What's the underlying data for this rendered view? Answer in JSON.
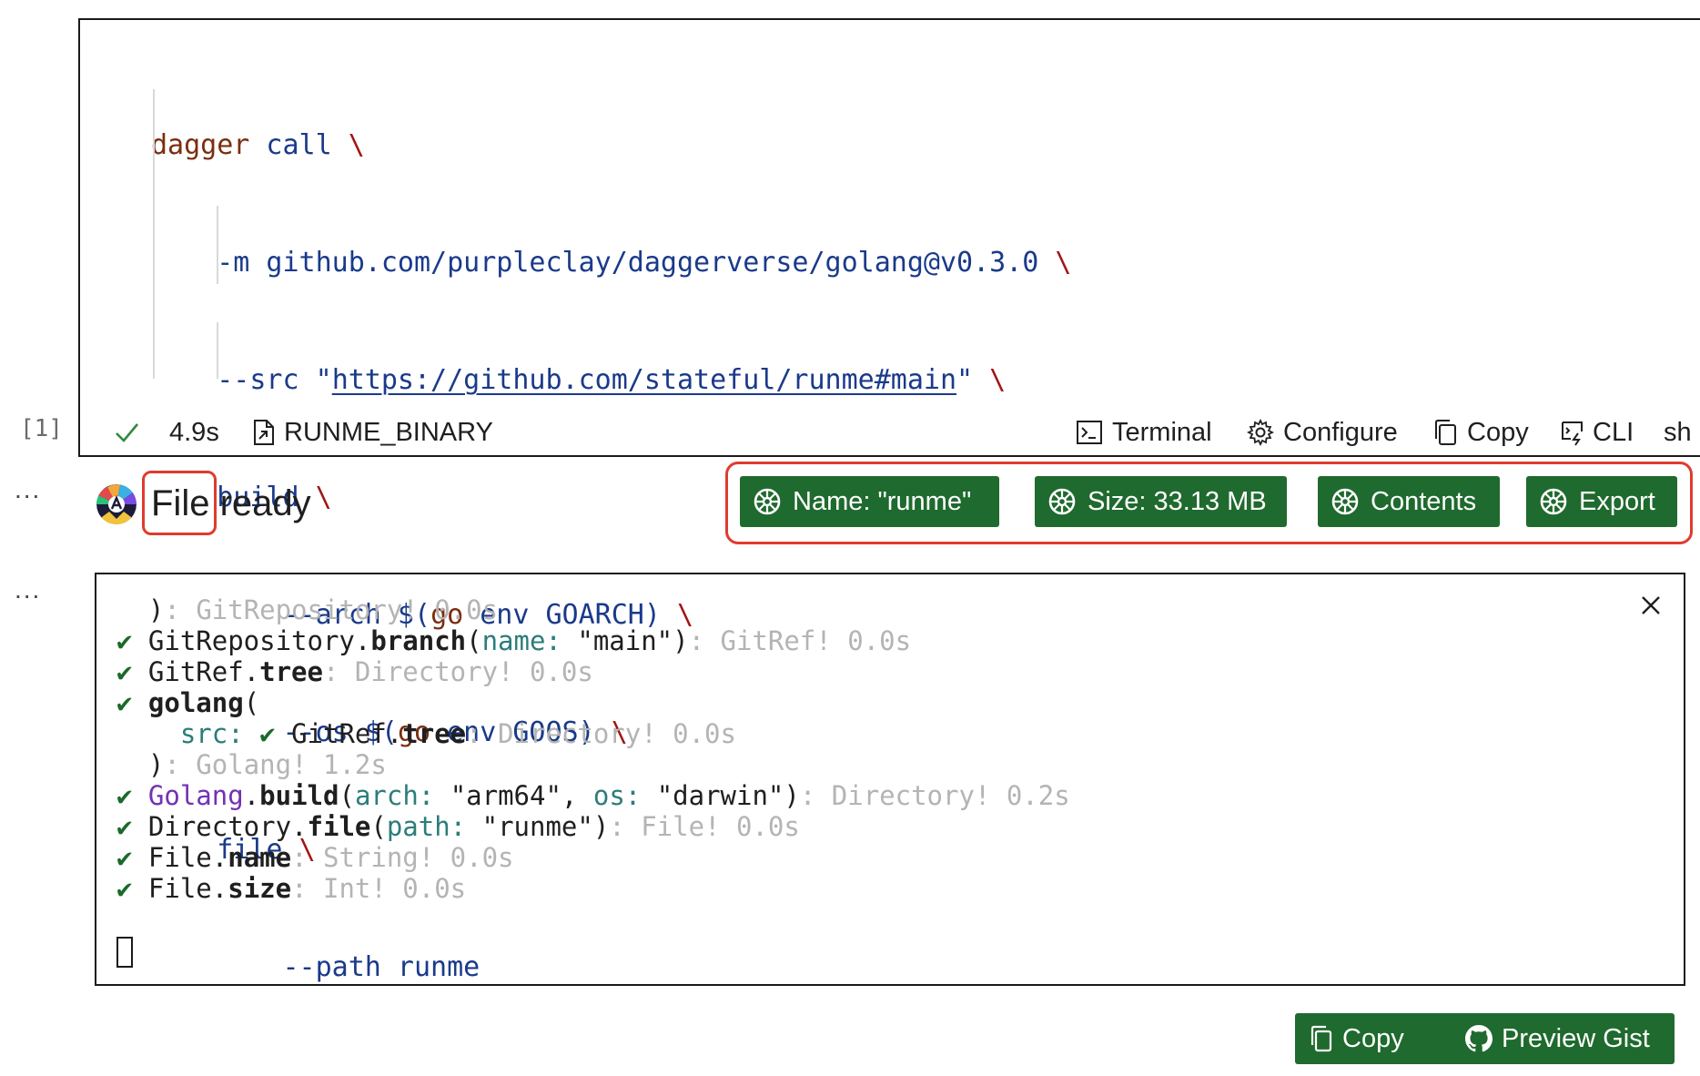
{
  "code_cell": {
    "lines": [
      {
        "kw": "dagger",
        "rest": " call ",
        "bs": "\\"
      },
      {
        "flag": "-m",
        "val": " github.com/purpleclay/daggerverse/golang@v0.3.0 ",
        "bs": "\\"
      },
      {
        "flag": "--src",
        "pre": " \"",
        "url": "https://github.com/stateful/runme#main",
        "post": "\" ",
        "bs": "\\"
      },
      {
        "val": "build ",
        "bs": "\\"
      },
      {
        "flag": "--arch",
        "pre": " $(",
        "kw": "go",
        "val": " env GOARCH",
        "post": ") ",
        "bs": "\\"
      },
      {
        "flag": "--os",
        "pre": " $(",
        "kw": "go",
        "val": " env GOOS",
        "post": ") ",
        "bs": "\\"
      },
      {
        "val": "file ",
        "bs": "\\"
      },
      {
        "flag": "--path",
        "val": " runme"
      }
    ],
    "exec_count": "[1]",
    "duration": "4.9s",
    "env_var": "RUNME_BINARY",
    "actions": {
      "terminal": "Terminal",
      "configure": "Configure",
      "copy": "Copy",
      "cli": "CLI",
      "shell": "sh"
    }
  },
  "output": {
    "more_dots": "...",
    "title_highlight": "File",
    "title_rest": " ready",
    "buttons": {
      "name": "Name: \"runme\"",
      "size": "Size: 33.13 MB",
      "contents": "Contents",
      "export": "Export"
    }
  },
  "terminal": {
    "more_dots": "...",
    "lines": [
      [
        {
          "t": "  ): ",
          "c": "gray-l"
        },
        {
          "t": "GitRepository! 0.0s",
          "c": "gray"
        }
      ],
      [
        {
          "t": "✔ ",
          "c": "chk"
        },
        {
          "t": "GitRepository."
        },
        {
          "t": "branch",
          "c": "b"
        },
        {
          "t": "("
        },
        {
          "t": "name:",
          "c": "teal"
        },
        {
          "t": " \"main\")"
        },
        {
          "t": ": GitRef! 0.0s",
          "c": "gray"
        }
      ],
      [
        {
          "t": "✔ ",
          "c": "chk"
        },
        {
          "t": "GitRef."
        },
        {
          "t": "tree",
          "c": "b"
        },
        {
          "t": ": Directory! 0.0s",
          "c": "gray"
        }
      ],
      [
        {
          "t": "✔ ",
          "c": "chk"
        },
        {
          "t": "golang",
          "c": "b"
        },
        {
          "t": "("
        }
      ],
      [
        {
          "t": "    "
        },
        {
          "t": "src:",
          "c": "teal"
        },
        {
          "t": " "
        },
        {
          "t": "✔ ",
          "c": "chk"
        },
        {
          "t": "GitRef."
        },
        {
          "t": "tree",
          "c": "b"
        },
        {
          "t": ": Directory! 0.0s",
          "c": "gray"
        }
      ],
      [
        {
          "t": "  )"
        },
        {
          "t": ": Golang! 1.2s",
          "c": "gray"
        }
      ],
      [
        {
          "t": "✔ ",
          "c": "chk"
        },
        {
          "t": "Golang",
          "c": "purple"
        },
        {
          "t": "."
        },
        {
          "t": "build",
          "c": "b"
        },
        {
          "t": "("
        },
        {
          "t": "arch:",
          "c": "teal"
        },
        {
          "t": " \"arm64\", "
        },
        {
          "t": "os:",
          "c": "teal"
        },
        {
          "t": " \"darwin\")"
        },
        {
          "t": ": Directory! 0.2s",
          "c": "gray"
        }
      ],
      [
        {
          "t": "✔ ",
          "c": "chk"
        },
        {
          "t": "Directory."
        },
        {
          "t": "file",
          "c": "b"
        },
        {
          "t": "("
        },
        {
          "t": "path:",
          "c": "teal"
        },
        {
          "t": " \"runme\")"
        },
        {
          "t": ": File! 0.0s",
          "c": "gray"
        }
      ],
      [
        {
          "t": "✔ ",
          "c": "chk"
        },
        {
          "t": "File."
        },
        {
          "t": "name",
          "c": "b"
        },
        {
          "t": ": String! 0.0s",
          "c": "gray"
        }
      ],
      [
        {
          "t": "✔ ",
          "c": "chk"
        },
        {
          "t": "File."
        },
        {
          "t": "size",
          "c": "b"
        },
        {
          "t": ": Int! 0.0s",
          "c": "gray"
        }
      ]
    ]
  },
  "footer_buttons": {
    "copy": "Copy",
    "preview_gist": "Preview Gist"
  },
  "colors": {
    "button_green": "#1f6a2e",
    "highlight_red": "#e03b2f"
  }
}
